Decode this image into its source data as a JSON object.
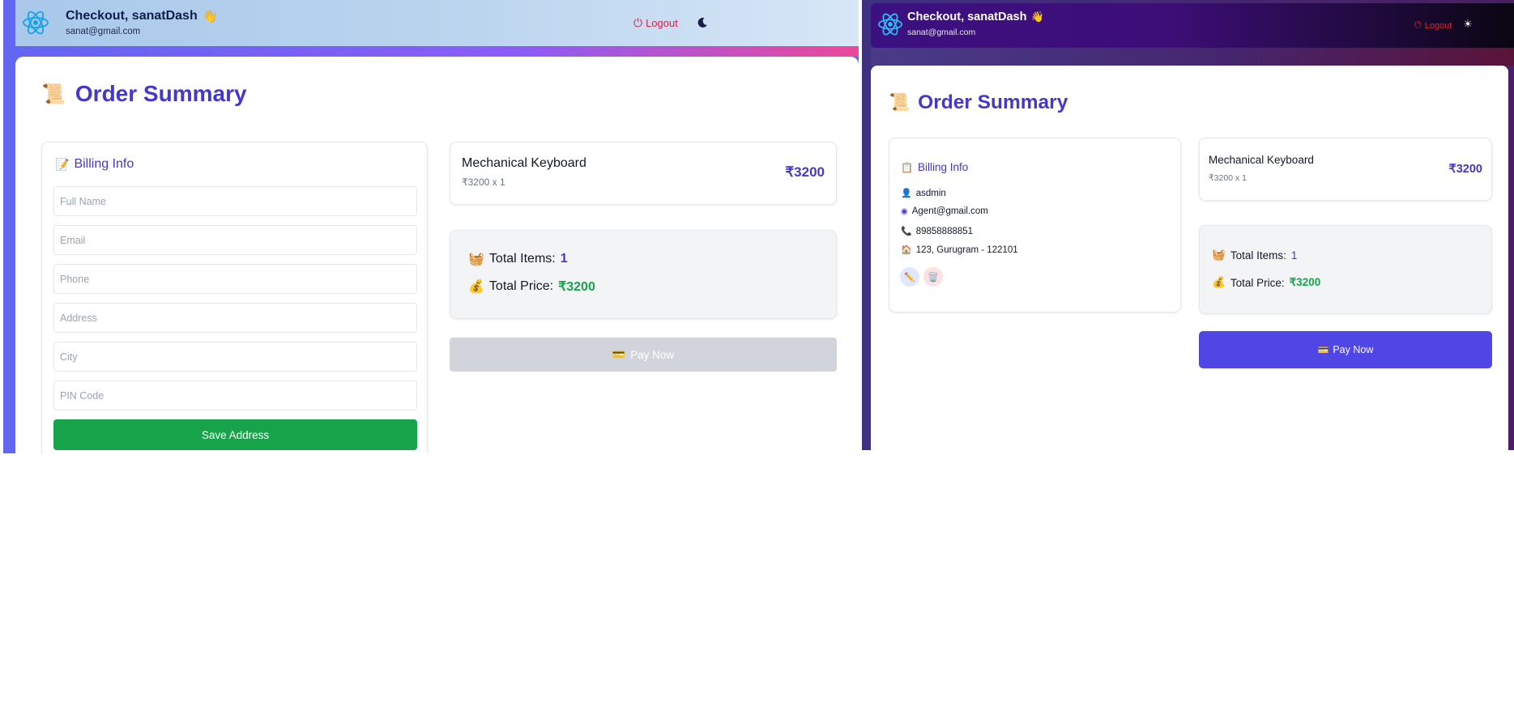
{
  "header": {
    "greeting": "Checkout, sanatDash",
    "wave_emoji": "👋",
    "email": "sanat@gmail.com",
    "logout_label": "Logout"
  },
  "page_title": "Order Summary",
  "billing": {
    "title": "Billing Info",
    "placeholders": {
      "full_name": "Full Name",
      "email": "Email",
      "phone": "Phone",
      "address": "Address",
      "city": "City",
      "pin": "PIN Code"
    },
    "save_label": "Save Address",
    "saved": {
      "name": "asdmin",
      "email": "Agent@gmail.com",
      "phone": "89858888851",
      "address": "123, Gurugram - 122101"
    }
  },
  "cart_item": {
    "name": "Mechanical Keyboard",
    "qty_line": "₹3200 x 1",
    "price": "₹3200"
  },
  "summary": {
    "items_label": "Total Items:",
    "items_value": "1",
    "price_label": "Total Price:",
    "price_value": "₹3200"
  },
  "pay_label": "Pay Now",
  "colors": {
    "brand_indigo": "#4338ca",
    "pay_active": "#4f46e5",
    "pay_disabled": "#d1d5db",
    "save_green": "#16a34a",
    "logout_red": "#e11d48",
    "price_green": "#16a34a"
  },
  "icons": [
    "react-logo-icon",
    "wave-emoji",
    "power-icon",
    "moon-icon",
    "sun-icon",
    "scroll-icon",
    "memo-icon",
    "clipboard-icon",
    "basket-icon",
    "money-bag-icon",
    "credit-card-icon",
    "user-icon",
    "at-icon",
    "phone-icon",
    "home-icon",
    "edit-pencil-icon",
    "trash-icon"
  ]
}
